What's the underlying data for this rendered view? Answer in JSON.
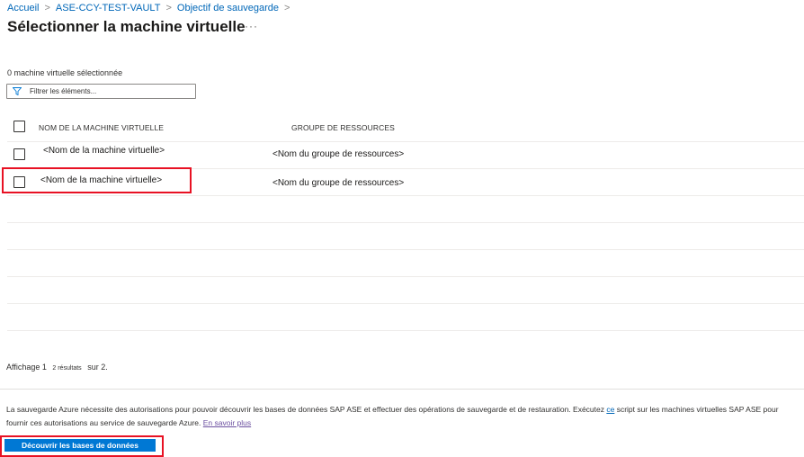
{
  "breadcrumb": {
    "items": [
      "Accueil",
      "ASE-CCY-TEST-VAULT",
      "Objectif de sauvegarde"
    ],
    "separator": ">"
  },
  "page": {
    "title": "Sélectionner la machine virtuelle",
    "more": "···"
  },
  "selection": {
    "count_text": "0 machine virtuelle sélectionnée"
  },
  "filter": {
    "placeholder": "Filtrer les éléments..."
  },
  "table": {
    "headers": [
      "NOM DE LA MACHINE VIRTUELLE",
      "GROUPE DE RESSOURCES"
    ],
    "rows": [
      {
        "vm": "<Nom de la machine virtuelle>",
        "group": "<Nom du groupe de ressources>"
      },
      {
        "vm": "<Nom de la machine virtuelle>",
        "group": "<Nom du groupe de ressources>"
      }
    ]
  },
  "paging": {
    "prefix": "Affichage 1",
    "results": "2 résultats",
    "suffix": "sur 2."
  },
  "info": {
    "text_1": "La sauvegarde Azure nécessite des autorisations pour pouvoir découvrir les bases de données SAP ASE et effectuer des opérations de sauvegarde et de restauration. Exécutez ",
    "link_1": "ce",
    "text_2": " script sur les machines virtuelles SAP ASE pour fournir ces autorisations au service de sauvegarde Azure. ",
    "link_2": "En savoir plus"
  },
  "actions": {
    "discover_label": "Découvrir les bases de données"
  },
  "colors": {
    "accent": "#0078d4",
    "link": "#0067b8",
    "highlight": "#e81123"
  }
}
